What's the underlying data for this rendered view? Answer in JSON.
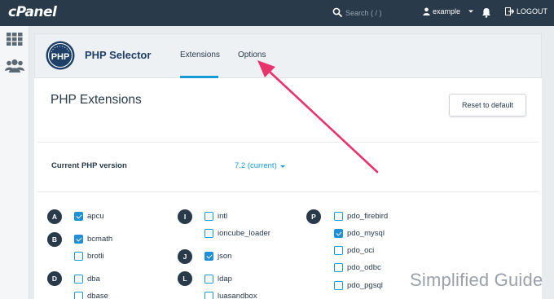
{
  "topbar": {
    "logo": "cPanel",
    "search_placeholder": "Search ( / )",
    "username": "example",
    "logout": "LOGOUT"
  },
  "sidebar": {
    "icons": [
      "grid-icon",
      "users-icon"
    ]
  },
  "header": {
    "php_logo_text": "PHP",
    "title": "PHP Selector",
    "tabs": [
      {
        "label": "Extensions",
        "active": true
      },
      {
        "label": "Options",
        "active": false
      }
    ]
  },
  "main": {
    "page_title": "PHP Extensions",
    "reset_button": "Reset to default",
    "php_version_label": "Current PHP version",
    "php_version_value": "7.2 (current)"
  },
  "extensions": {
    "col1": [
      {
        "letter": "A",
        "name": "apcu",
        "checked": true
      },
      {
        "letter": "B",
        "name": "bcmath",
        "checked": true
      },
      {
        "letter": "",
        "name": "brotli",
        "checked": false
      },
      {
        "letter": "D",
        "name": "dba",
        "checked": false
      },
      {
        "letter": "",
        "name": "dbase",
        "checked": false
      }
    ],
    "col2": [
      {
        "letter": "I",
        "name": "intl",
        "checked": false
      },
      {
        "letter": "",
        "name": "ioncube_loader",
        "checked": false
      },
      {
        "letter": "J",
        "name": "json",
        "checked": true
      },
      {
        "letter": "L",
        "name": "ldap",
        "checked": false
      },
      {
        "letter": "",
        "name": "luasandbox",
        "checked": false
      }
    ],
    "col3": [
      {
        "letter": "P",
        "name": "pdo_firebird",
        "checked": false
      },
      {
        "letter": "",
        "name": "pdo_mysql",
        "checked": true
      },
      {
        "letter": "",
        "name": "pdo_oci",
        "checked": false
      },
      {
        "letter": "",
        "name": "pdo_odbc",
        "checked": false
      },
      {
        "letter": "",
        "name": "pdo_pgsql",
        "checked": false
      }
    ]
  },
  "watermark": "Simplified Guide",
  "colors": {
    "topbar": "#293a4a",
    "accent": "#179bd7",
    "arrow": "#e8336d"
  }
}
